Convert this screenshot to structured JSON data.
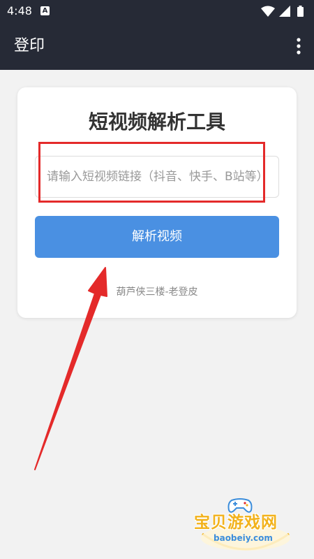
{
  "status_bar": {
    "time": "4:48",
    "notification_badge": "A"
  },
  "app_bar": {
    "title": "登印"
  },
  "card": {
    "title": "短视频解析工具",
    "input_placeholder": "请输入短视频链接（抖音、快手、B站等）",
    "input_value": "",
    "button_label": "解析视频",
    "footer_text": "葫芦侠三楼-老登皮"
  },
  "watermark": {
    "brand": "宝贝游戏网",
    "url": "baobeiy.com"
  },
  "colors": {
    "app_bar_bg": "#262a36",
    "page_bg": "#f2f2f2",
    "button_bg": "#4a90e2",
    "highlight": "#e42a2a",
    "watermark_gold": "#f2b21c",
    "watermark_blue": "#3b8ddb"
  },
  "icons": {
    "status": [
      "wifi-icon",
      "signal-icon",
      "battery-icon"
    ],
    "app_bar": "more-vert-icon"
  }
}
